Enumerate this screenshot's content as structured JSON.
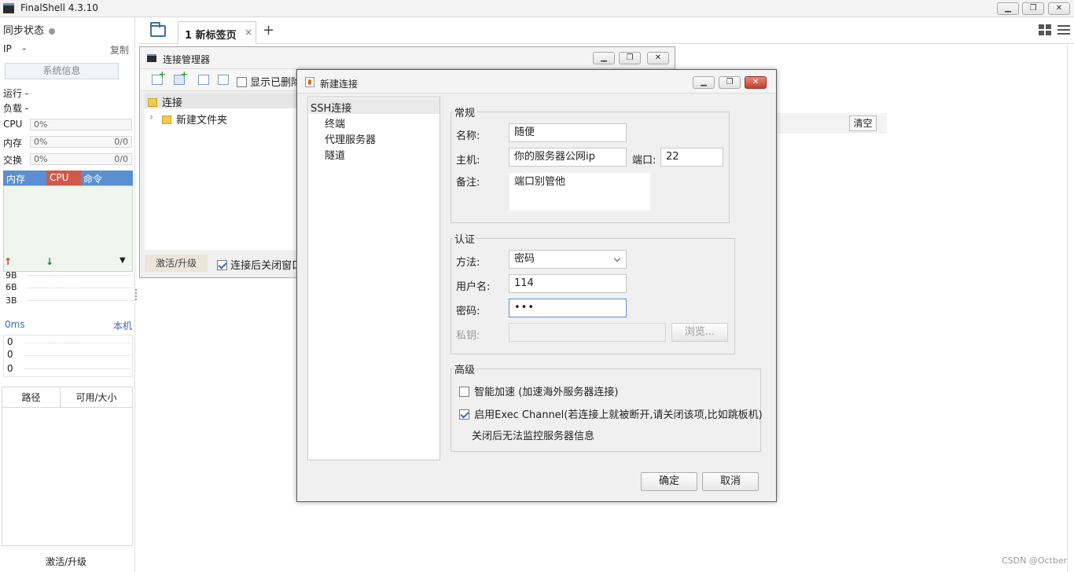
{
  "window": {
    "title": "FinalShell 4.3.10"
  },
  "sidebar": {
    "sync_label": "同步状态",
    "ip_label": "IP",
    "ip_value": "-",
    "copy_label": "复制",
    "sysinfo_button": "系统信息",
    "run_label": "运行 -",
    "load_label": "负载 -",
    "cpu": {
      "label": "CPU",
      "value": "0%"
    },
    "mem": {
      "label": "内存",
      "value": "0%",
      "ratio": "0/0"
    },
    "swap": {
      "label": "交换",
      "value": "0%",
      "ratio": "0/0"
    },
    "proc_tabs": [
      "内存",
      "CPU",
      "命令"
    ],
    "net_scale": [
      "9B",
      "6B",
      "3B"
    ],
    "ping": {
      "value": "0ms",
      "target": "本机",
      "rows": [
        "0",
        "0",
        "0"
      ]
    },
    "files": {
      "col_path": "路径",
      "col_size": "可用/大小"
    },
    "upgrade_label": "激活/升级"
  },
  "tabs": [
    {
      "label": "1 新标签页",
      "close": "×"
    }
  ],
  "tab_add": "+",
  "clear_button": "清空",
  "conn_manager": {
    "title": "连接管理器",
    "show_deleted": "显示已删除",
    "tree": {
      "root": "连接",
      "folder": "新建文件夹",
      "expander": "›"
    },
    "upgrade_label": "激活/升级",
    "close_after_connect": "连接后关闭窗口"
  },
  "dialog": {
    "title": "新建连接",
    "tree": {
      "root": "SSH连接",
      "items": [
        "终端",
        "代理服务器",
        "隧道"
      ]
    },
    "general": {
      "legend": "常规",
      "name_label": "名称:",
      "name_value": "随便",
      "host_label": "主机:",
      "host_value": "你的服务器公网ip",
      "port_label": "端口:",
      "port_value": "22",
      "note_label": "备注:",
      "note_value": "端口别管他"
    },
    "auth": {
      "legend": "认证",
      "method_label": "方法:",
      "method_value": "密码",
      "user_label": "用户名:",
      "user_value": "114",
      "password_label": "密码:",
      "password_value": "•••",
      "key_label": "私钥:",
      "browse_button": "浏览..."
    },
    "advanced": {
      "legend": "高级",
      "smart_accel": "智能加速 (加速海外服务器连接)",
      "exec_channel": "启用Exec Channel(若连接上就被断开,请关闭该项,比如跳板机)",
      "exec_note": "关闭后无法监控服务器信息"
    },
    "ok_button": "确定",
    "cancel_button": "取消"
  },
  "watermark": "CSDN @Octber"
}
